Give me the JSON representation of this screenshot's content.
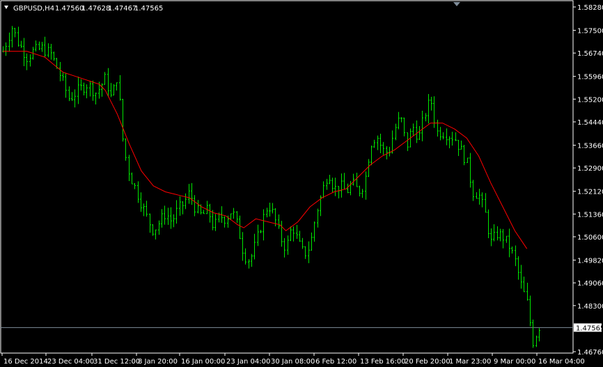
{
  "header": {
    "symbol": "GBPUSD,H4",
    "open": "1.47560",
    "high": "1.47628",
    "low": "1.47467",
    "close": "1.47565"
  },
  "colors": {
    "background": "#000000",
    "candles": "#00e600",
    "moving_average": "#ff0000",
    "axis": "#ffffff",
    "current_price_line": "#7f8c99",
    "price_label_bg": "#ffffff",
    "price_label_text": "#000000"
  },
  "icons": {
    "menu": "triangle-down-icon",
    "shift_marker": "triangle-down-icon"
  },
  "chart_data": {
    "type": "ohlc",
    "title": "GBPUSD,H4",
    "ylim": [
      1.4676,
      1.5828
    ],
    "y_ticks": [
      "1.58280",
      "1.57500",
      "1.56740",
      "1.55960",
      "1.55200",
      "1.54440",
      "1.53660",
      "1.52900",
      "1.52120",
      "1.51360",
      "1.50600",
      "1.49820",
      "1.49060",
      "1.48300",
      "1.46760"
    ],
    "x_ticks": [
      "16 Dec 2014",
      "23 Dec 04:00",
      "31 Dec 12:00",
      "8 Jan 20:00",
      "16 Jan 00:00",
      "23 Jan 04:00",
      "30 Jan 08:00",
      "6 Feb 12:00",
      "13 Feb 16:00",
      "20 Feb 20:00",
      "1 Mar 23:00",
      "9 Mar 00:00",
      "16 Mar 04:00"
    ],
    "current_price": "1.47565",
    "close_path": [
      [
        0,
        1.568
      ],
      [
        3,
        1.576
      ],
      [
        5,
        1.571
      ],
      [
        8,
        1.566
      ],
      [
        10,
        1.568
      ],
      [
        13,
        1.569
      ],
      [
        16,
        1.567
      ],
      [
        19,
        1.56
      ],
      [
        22,
        1.552
      ],
      [
        25,
        1.555
      ],
      [
        28,
        1.557
      ],
      [
        31,
        1.554
      ],
      [
        34,
        1.559
      ],
      [
        36,
        1.552
      ],
      [
        38,
        1.56
      ],
      [
        40,
        1.536
      ],
      [
        42,
        1.527
      ],
      [
        44,
        1.522
      ],
      [
        46,
        1.517
      ],
      [
        48,
        1.512
      ],
      [
        50,
        1.508
      ],
      [
        52,
        1.511
      ],
      [
        54,
        1.514
      ],
      [
        56,
        1.511
      ],
      [
        58,
        1.515
      ],
      [
        60,
        1.517
      ],
      [
        62,
        1.521
      ],
      [
        64,
        1.515
      ],
      [
        66,
        1.513
      ],
      [
        68,
        1.515
      ],
      [
        70,
        1.509
      ],
      [
        72,
        1.513
      ],
      [
        74,
        1.512
      ],
      [
        76,
        1.515
      ],
      [
        78,
        1.509
      ],
      [
        80,
        1.5
      ],
      [
        82,
        1.498
      ],
      [
        84,
        1.504
      ],
      [
        86,
        1.511
      ],
      [
        88,
        1.517
      ],
      [
        90,
        1.513
      ],
      [
        92,
        1.506
      ],
      [
        94,
        1.502
      ],
      [
        96,
        1.51
      ],
      [
        98,
        1.504
      ],
      [
        100,
        1.5
      ],
      [
        102,
        1.503
      ],
      [
        104,
        1.514
      ],
      [
        106,
        1.521
      ],
      [
        108,
        1.528
      ],
      [
        110,
        1.522
      ],
      [
        112,
        1.523
      ],
      [
        114,
        1.521
      ],
      [
        116,
        1.524
      ],
      [
        118,
        1.521
      ],
      [
        120,
        1.524
      ],
      [
        122,
        1.537
      ],
      [
        124,
        1.54
      ],
      [
        126,
        1.535
      ],
      [
        128,
        1.534
      ],
      [
        130,
        1.542
      ],
      [
        132,
        1.546
      ],
      [
        134,
        1.536
      ],
      [
        136,
        1.543
      ],
      [
        138,
        1.539
      ],
      [
        140,
        1.547
      ],
      [
        142,
        1.552
      ],
      [
        144,
        1.541
      ],
      [
        146,
        1.541
      ],
      [
        148,
        1.54
      ],
      [
        150,
        1.539
      ],
      [
        152,
        1.535
      ],
      [
        154,
        1.531
      ],
      [
        156,
        1.521
      ],
      [
        158,
        1.52
      ],
      [
        160,
        1.514
      ],
      [
        162,
        1.504
      ],
      [
        164,
        1.507
      ],
      [
        166,
        1.506
      ],
      [
        168,
        1.503
      ],
      [
        170,
        1.498
      ],
      [
        172,
        1.49
      ],
      [
        174,
        1.484
      ],
      [
        176,
        1.471
      ],
      [
        178,
        1.476
      ]
    ],
    "ma_path": [
      [
        0,
        1.568
      ],
      [
        8,
        1.568
      ],
      [
        14,
        1.566
      ],
      [
        20,
        1.561
      ],
      [
        26,
        1.559
      ],
      [
        32,
        1.557
      ],
      [
        34,
        1.555
      ],
      [
        38,
        1.547
      ],
      [
        42,
        1.537
      ],
      [
        46,
        1.528
      ],
      [
        50,
        1.523
      ],
      [
        54,
        1.521
      ],
      [
        58,
        1.52
      ],
      [
        62,
        1.519
      ],
      [
        66,
        1.516
      ],
      [
        70,
        1.514
      ],
      [
        74,
        1.513
      ],
      [
        78,
        1.51
      ],
      [
        80,
        1.509
      ],
      [
        84,
        1.512
      ],
      [
        88,
        1.511
      ],
      [
        92,
        1.51
      ],
      [
        94,
        1.508
      ],
      [
        98,
        1.511
      ],
      [
        102,
        1.516
      ],
      [
        106,
        1.519
      ],
      [
        110,
        1.521
      ],
      [
        114,
        1.522
      ],
      [
        118,
        1.526
      ],
      [
        122,
        1.53
      ],
      [
        126,
        1.533
      ],
      [
        130,
        1.535
      ],
      [
        134,
        1.538
      ],
      [
        138,
        1.541
      ],
      [
        142,
        1.544
      ],
      [
        146,
        1.544
      ],
      [
        150,
        1.542
      ],
      [
        154,
        1.539
      ],
      [
        158,
        1.533
      ],
      [
        162,
        1.524
      ],
      [
        166,
        1.516
      ],
      [
        170,
        1.508
      ],
      [
        174,
        1.502
      ]
    ]
  }
}
